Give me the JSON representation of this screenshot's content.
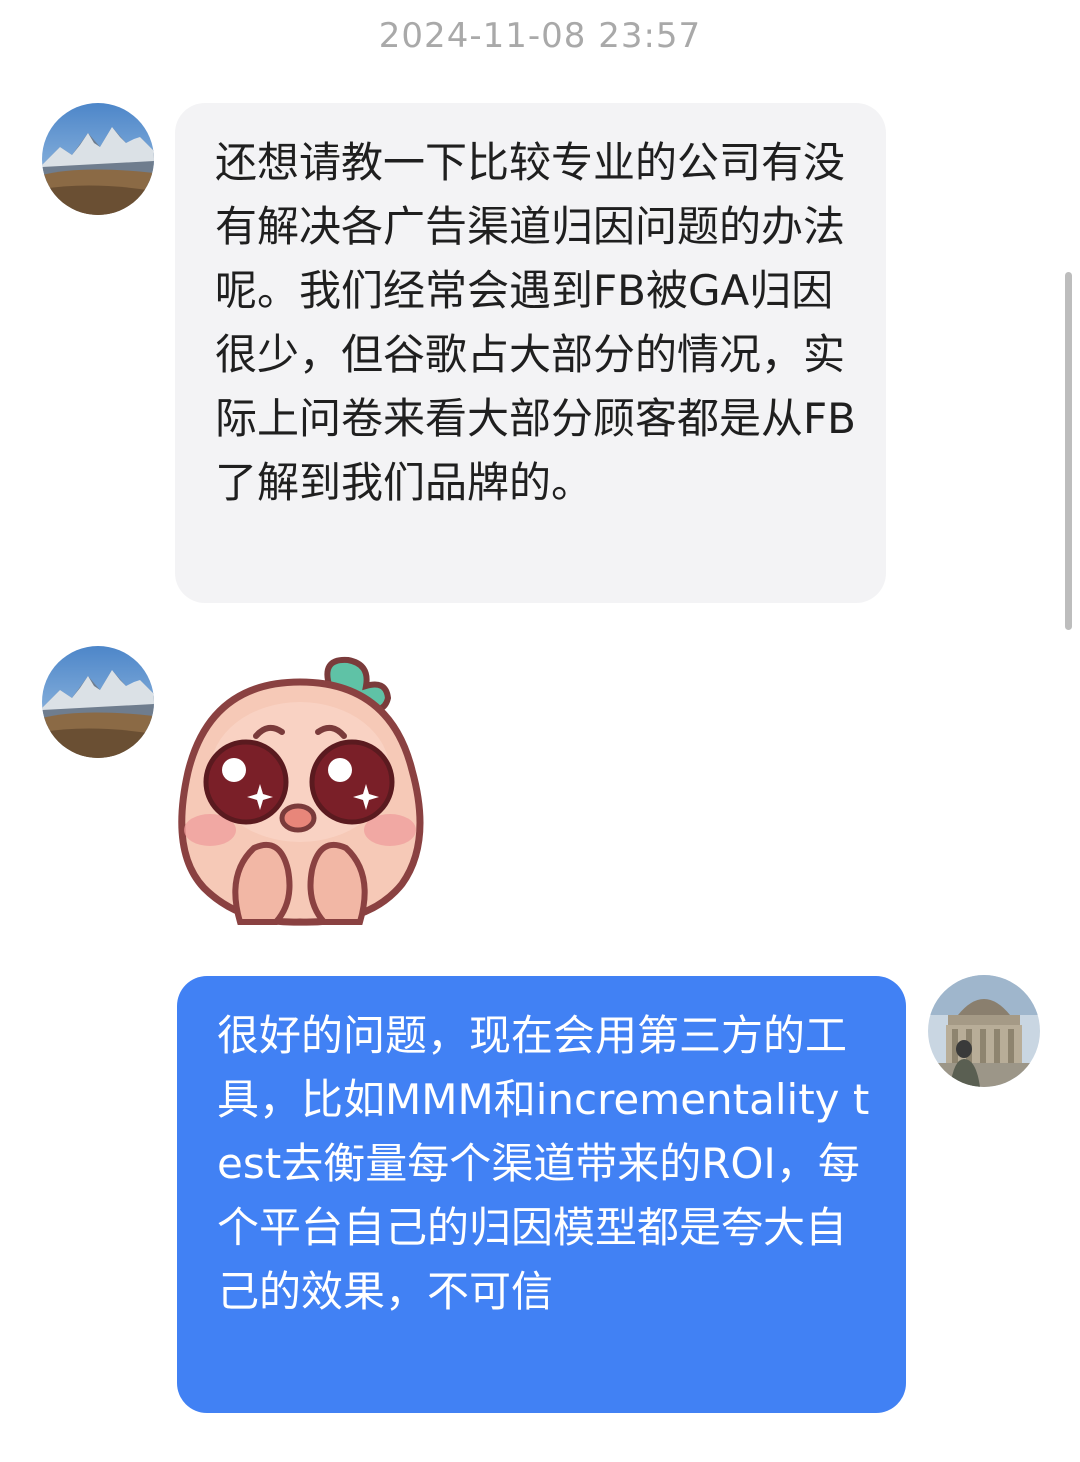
{
  "chat": {
    "timestamp": "2024-11-08 23:57",
    "messages": [
      {
        "sender": "contact",
        "type": "text",
        "avatar_icon": "mountain-landscape-avatar",
        "text": "还想请教一下比较专业的公司有没有解决各广告渠道归因问题的办法呢。我们经常会遇到FB被GA归因很少，但谷歌占大部分的情况，实际上问卷来看大部分顾客都是从FB了解到我们品牌的。"
      },
      {
        "sender": "contact",
        "type": "sticker",
        "avatar_icon": "mountain-landscape-avatar",
        "sticker_icon": "pleading-peach-sticker"
      },
      {
        "sender": "self",
        "type": "text",
        "avatar_icon": "building-landmark-avatar",
        "text": "很好的问题，现在会用第三方的工具，比如MMM和incrementality test去衡量每个渠道带来的ROI，每个平台自己的归因模型都是夸大自己的效果，不可信"
      }
    ]
  },
  "colors": {
    "incoming_bubble": "#f3f3f5",
    "outgoing_bubble": "#4181f4",
    "timestamp_text": "#a9a9a9"
  }
}
